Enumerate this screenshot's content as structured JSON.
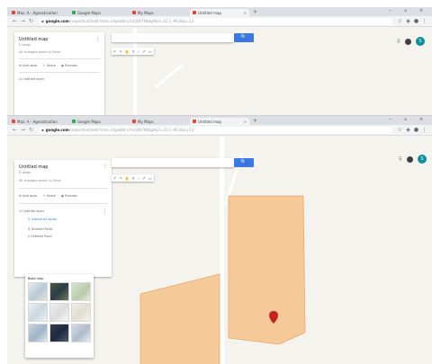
{
  "browser": {
    "tabs": [
      {
        "label": "Mac: A - Agnostication",
        "color": "#ea4335"
      },
      {
        "label": "Google Maps",
        "color": "#34a853"
      },
      {
        "label": "My Maps",
        "color": "#ea4335"
      },
      {
        "label": "Untitled map",
        "color": "#ea4335",
        "active": true
      }
    ],
    "address": {
      "host": "google.com",
      "path": "/maps/d/u/0/edit?mid=1dpekNcu7aVjQhTNtbgA&ll=32.2,-96.8&z=13"
    }
  },
  "panel": {
    "title": "Untitled map",
    "subtitle": "0 views",
    "saved_note": "All changes saved in Drive",
    "add_layer": "Add layer",
    "share": "Share",
    "preview": "Preview",
    "layer_name": "Untitled layer",
    "individual_styles": "Individual styles",
    "point_1": "Untitled Point",
    "point_2": "Untitled Point"
  },
  "basemap": {
    "title": "Base map"
  },
  "search": {
    "value": ""
  },
  "colors": {
    "map_bg": "#f5f3ee",
    "polygon_fill": "#f5c998",
    "polygon_stroke": "#e8a86a",
    "marker": "#c5221f",
    "search_button": "#3b78e7",
    "avatar": "#0b8fa0"
  }
}
